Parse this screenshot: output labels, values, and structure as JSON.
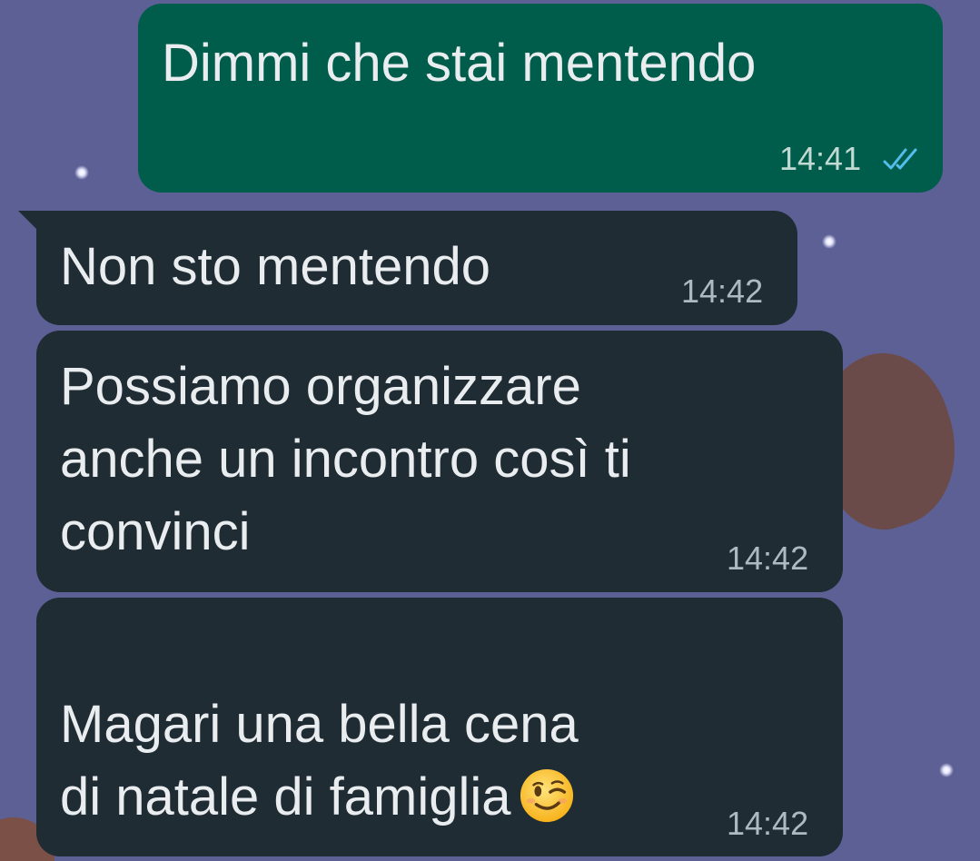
{
  "chat": {
    "messages": [
      {
        "direction": "outgoing",
        "text": "Dimmi che stai mentendo",
        "time": "14:41",
        "status": "read",
        "status_icon": "double-check-icon",
        "status_color": "#53bdeb"
      },
      {
        "direction": "incoming",
        "text": "Non sto mentendo",
        "time": "14:42"
      },
      {
        "direction": "incoming",
        "text": "Possiamo organizzare\nanche un incontro così ti\nconvinci",
        "time": "14:42"
      },
      {
        "direction": "incoming",
        "text": "Magari una bella cena\ndi natale di famiglia",
        "emoji": "winking-face-emoji",
        "time": "14:42"
      }
    ]
  },
  "colors": {
    "outgoing_bubble": "#005c4b",
    "incoming_bubble": "#202c33",
    "wallpaper": "#5d6094",
    "read_ticks": "#53bdeb"
  }
}
